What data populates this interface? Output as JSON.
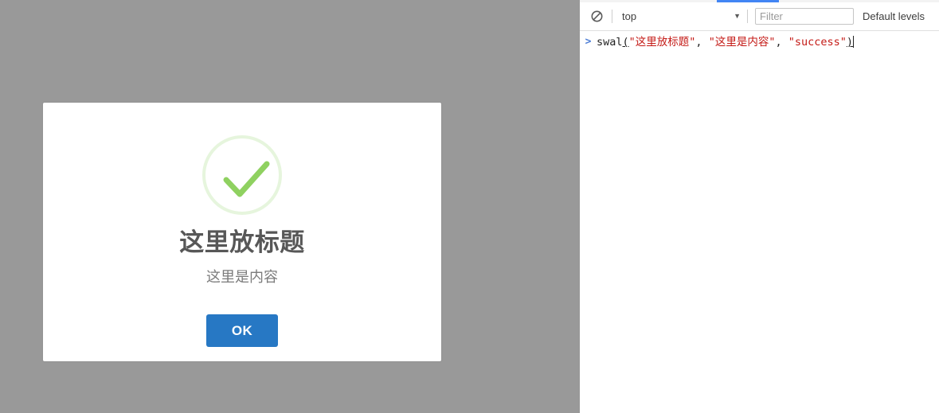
{
  "page": {
    "overlay_color": "#999999",
    "modal": {
      "icon_name": "success-check-icon",
      "icon_color": "#a5dc86",
      "title": "这里放标题",
      "text": "这里是内容",
      "confirm_label": "OK",
      "confirm_color": "#2778c4"
    }
  },
  "devtools": {
    "tab_indicator_color": "#4285f4",
    "toolbar": {
      "clear_icon": "clear-console-icon",
      "context_value": "top",
      "context_caret": "▼",
      "filter_placeholder": "Filter",
      "filter_value": "",
      "level_label": "Default levels"
    },
    "console": {
      "prompt": ">",
      "input_tokens": [
        {
          "type": "ident",
          "text": "swal"
        },
        {
          "type": "bracket",
          "text": "("
        },
        {
          "type": "string",
          "text": "\"这里放标题\""
        },
        {
          "type": "punct",
          "text": ", "
        },
        {
          "type": "string",
          "text": "\"这里是内容\""
        },
        {
          "type": "punct",
          "text": ", "
        },
        {
          "type": "string",
          "text": "\"success\""
        },
        {
          "type": "bracket",
          "text": ")"
        }
      ],
      "input_plain": "swal(\"这里放标题\", \"这里是内容\", \"success\")"
    }
  }
}
